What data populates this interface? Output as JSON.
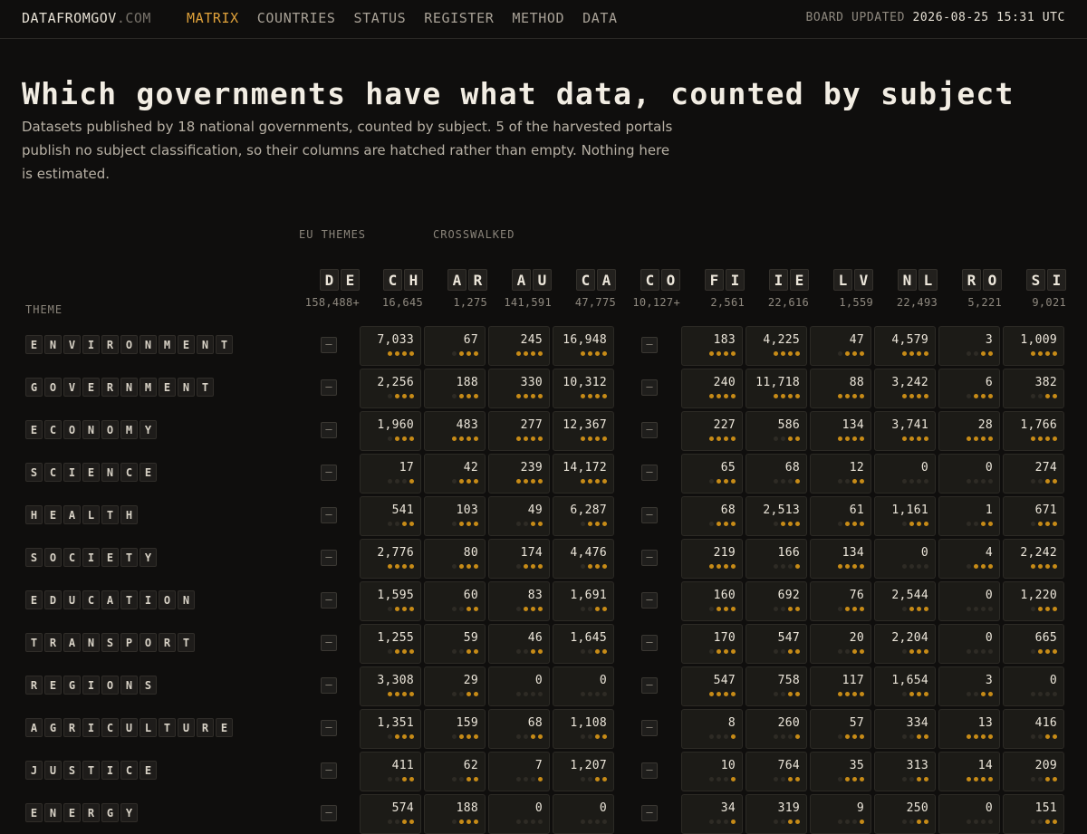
{
  "nav": {
    "brand_main": "DATAFROMGOV",
    "brand_suffix": ".COM",
    "links": [
      "MATRIX",
      "COUNTRIES",
      "STATUS",
      "REGISTER",
      "METHOD",
      "DATA"
    ],
    "active": "MATRIX",
    "updated_label": "BOARD UPDATED",
    "updated_value": "2026-08-25 15:31 UTC"
  },
  "title": "Which governments have what data, counted by subject",
  "subtitle": "Datasets published by 18 national governments, counted by subject. 5 of the harvested portals publish no subject classification, so their columns are hatched rather than empty. Nothing here is estimated.",
  "group_labels": [
    "EU THEMES",
    "CROSSWALKED"
  ],
  "theme_header": "THEME",
  "hatched_glyph": "—",
  "columns": [
    {
      "code": "DE",
      "total": "158,488+",
      "hatched": true
    },
    {
      "code": "CH",
      "total": "16,645",
      "hatched": false
    },
    {
      "code": "AR",
      "total": "1,275",
      "hatched": false
    },
    {
      "code": "AU",
      "total": "141,591",
      "hatched": false
    },
    {
      "code": "CA",
      "total": "47,775",
      "hatched": false
    },
    {
      "code": "CO",
      "total": "10,127+",
      "hatched": true
    },
    {
      "code": "FI",
      "total": "2,561",
      "hatched": false
    },
    {
      "code": "IE",
      "total": "22,616",
      "hatched": false
    },
    {
      "code": "LV",
      "total": "1,559",
      "hatched": false
    },
    {
      "code": "NL",
      "total": "22,493",
      "hatched": false
    },
    {
      "code": "RO",
      "total": "5,221",
      "hatched": false
    },
    {
      "code": "SI",
      "total": "9,021",
      "hatched": false
    }
  ],
  "rows": [
    {
      "theme": "ENVIRONMENT",
      "cells": [
        {
          "v": "7,033",
          "d": 4
        },
        {
          "v": "67",
          "d": 3
        },
        {
          "v": "245",
          "d": 4
        },
        {
          "v": "16,948",
          "d": 4
        },
        {
          "v": "183",
          "d": 4
        },
        {
          "v": "4,225",
          "d": 4
        },
        {
          "v": "47",
          "d": 3
        },
        {
          "v": "4,579",
          "d": 4
        },
        {
          "v": "3",
          "d": 2
        },
        {
          "v": "1,009",
          "d": 4
        }
      ]
    },
    {
      "theme": "GOVERNMENT",
      "cells": [
        {
          "v": "2,256",
          "d": 3
        },
        {
          "v": "188",
          "d": 3
        },
        {
          "v": "330",
          "d": 4
        },
        {
          "v": "10,312",
          "d": 4
        },
        {
          "v": "240",
          "d": 4
        },
        {
          "v": "11,718",
          "d": 4
        },
        {
          "v": "88",
          "d": 4
        },
        {
          "v": "3,242",
          "d": 4
        },
        {
          "v": "6",
          "d": 3
        },
        {
          "v": "382",
          "d": 2
        }
      ]
    },
    {
      "theme": "ECONOMY",
      "cells": [
        {
          "v": "1,960",
          "d": 3
        },
        {
          "v": "483",
          "d": 4
        },
        {
          "v": "277",
          "d": 4
        },
        {
          "v": "12,367",
          "d": 4
        },
        {
          "v": "227",
          "d": 4
        },
        {
          "v": "586",
          "d": 2
        },
        {
          "v": "134",
          "d": 4
        },
        {
          "v": "3,741",
          "d": 4
        },
        {
          "v": "28",
          "d": 4
        },
        {
          "v": "1,766",
          "d": 4
        }
      ]
    },
    {
      "theme": "SCIENCE",
      "cells": [
        {
          "v": "17",
          "d": 1
        },
        {
          "v": "42",
          "d": 3
        },
        {
          "v": "239",
          "d": 4
        },
        {
          "v": "14,172",
          "d": 4
        },
        {
          "v": "65",
          "d": 3
        },
        {
          "v": "68",
          "d": 1
        },
        {
          "v": "12",
          "d": 2
        },
        {
          "v": "0",
          "d": 0
        },
        {
          "v": "0",
          "d": 0
        },
        {
          "v": "274",
          "d": 2
        }
      ]
    },
    {
      "theme": "HEALTH",
      "cells": [
        {
          "v": "541",
          "d": 2
        },
        {
          "v": "103",
          "d": 3
        },
        {
          "v": "49",
          "d": 2
        },
        {
          "v": "6,287",
          "d": 3
        },
        {
          "v": "68",
          "d": 3
        },
        {
          "v": "2,513",
          "d": 3
        },
        {
          "v": "61",
          "d": 3
        },
        {
          "v": "1,161",
          "d": 3
        },
        {
          "v": "1",
          "d": 2
        },
        {
          "v": "671",
          "d": 3
        }
      ]
    },
    {
      "theme": "SOCIETY",
      "cells": [
        {
          "v": "2,776",
          "d": 4
        },
        {
          "v": "80",
          "d": 3
        },
        {
          "v": "174",
          "d": 3
        },
        {
          "v": "4,476",
          "d": 3
        },
        {
          "v": "219",
          "d": 4
        },
        {
          "v": "166",
          "d": 1
        },
        {
          "v": "134",
          "d": 4
        },
        {
          "v": "0",
          "d": 0
        },
        {
          "v": "4",
          "d": 3
        },
        {
          "v": "2,242",
          "d": 4
        }
      ]
    },
    {
      "theme": "EDUCATION",
      "cells": [
        {
          "v": "1,595",
          "d": 3
        },
        {
          "v": "60",
          "d": 2
        },
        {
          "v": "83",
          "d": 3
        },
        {
          "v": "1,691",
          "d": 2
        },
        {
          "v": "160",
          "d": 3
        },
        {
          "v": "692",
          "d": 2
        },
        {
          "v": "76",
          "d": 3
        },
        {
          "v": "2,544",
          "d": 3
        },
        {
          "v": "0",
          "d": 0
        },
        {
          "v": "1,220",
          "d": 3
        }
      ]
    },
    {
      "theme": "TRANSPORT",
      "cells": [
        {
          "v": "1,255",
          "d": 3
        },
        {
          "v": "59",
          "d": 2
        },
        {
          "v": "46",
          "d": 2
        },
        {
          "v": "1,645",
          "d": 2
        },
        {
          "v": "170",
          "d": 3
        },
        {
          "v": "547",
          "d": 2
        },
        {
          "v": "20",
          "d": 2
        },
        {
          "v": "2,204",
          "d": 3
        },
        {
          "v": "0",
          "d": 0
        },
        {
          "v": "665",
          "d": 3
        }
      ]
    },
    {
      "theme": "REGIONS",
      "cells": [
        {
          "v": "3,308",
          "d": 4
        },
        {
          "v": "29",
          "d": 2
        },
        {
          "v": "0",
          "d": 0
        },
        {
          "v": "0",
          "d": 0
        },
        {
          "v": "547",
          "d": 4
        },
        {
          "v": "758",
          "d": 2
        },
        {
          "v": "117",
          "d": 4
        },
        {
          "v": "1,654",
          "d": 3
        },
        {
          "v": "3",
          "d": 2
        },
        {
          "v": "0",
          "d": 0
        }
      ]
    },
    {
      "theme": "AGRICULTURE",
      "cells": [
        {
          "v": "1,351",
          "d": 3
        },
        {
          "v": "159",
          "d": 3
        },
        {
          "v": "68",
          "d": 2
        },
        {
          "v": "1,108",
          "d": 2
        },
        {
          "v": "8",
          "d": 1
        },
        {
          "v": "260",
          "d": 1
        },
        {
          "v": "57",
          "d": 3
        },
        {
          "v": "334",
          "d": 2
        },
        {
          "v": "13",
          "d": 4
        },
        {
          "v": "416",
          "d": 2
        }
      ]
    },
    {
      "theme": "JUSTICE",
      "cells": [
        {
          "v": "411",
          "d": 2
        },
        {
          "v": "62",
          "d": 2
        },
        {
          "v": "7",
          "d": 1
        },
        {
          "v": "1,207",
          "d": 2
        },
        {
          "v": "10",
          "d": 1
        },
        {
          "v": "764",
          "d": 2
        },
        {
          "v": "35",
          "d": 3
        },
        {
          "v": "313",
          "d": 2
        },
        {
          "v": "14",
          "d": 4
        },
        {
          "v": "209",
          "d": 2
        }
      ]
    },
    {
      "theme": "ENERGY",
      "cells": [
        {
          "v": "574",
          "d": 2
        },
        {
          "v": "188",
          "d": 3
        },
        {
          "v": "0",
          "d": 0
        },
        {
          "v": "0",
          "d": 0
        },
        {
          "v": "34",
          "d": 1
        },
        {
          "v": "319",
          "d": 2
        },
        {
          "v": "9",
          "d": 1
        },
        {
          "v": "250",
          "d": 2
        },
        {
          "v": "0",
          "d": 0
        },
        {
          "v": "151",
          "d": 2
        }
      ]
    }
  ]
}
